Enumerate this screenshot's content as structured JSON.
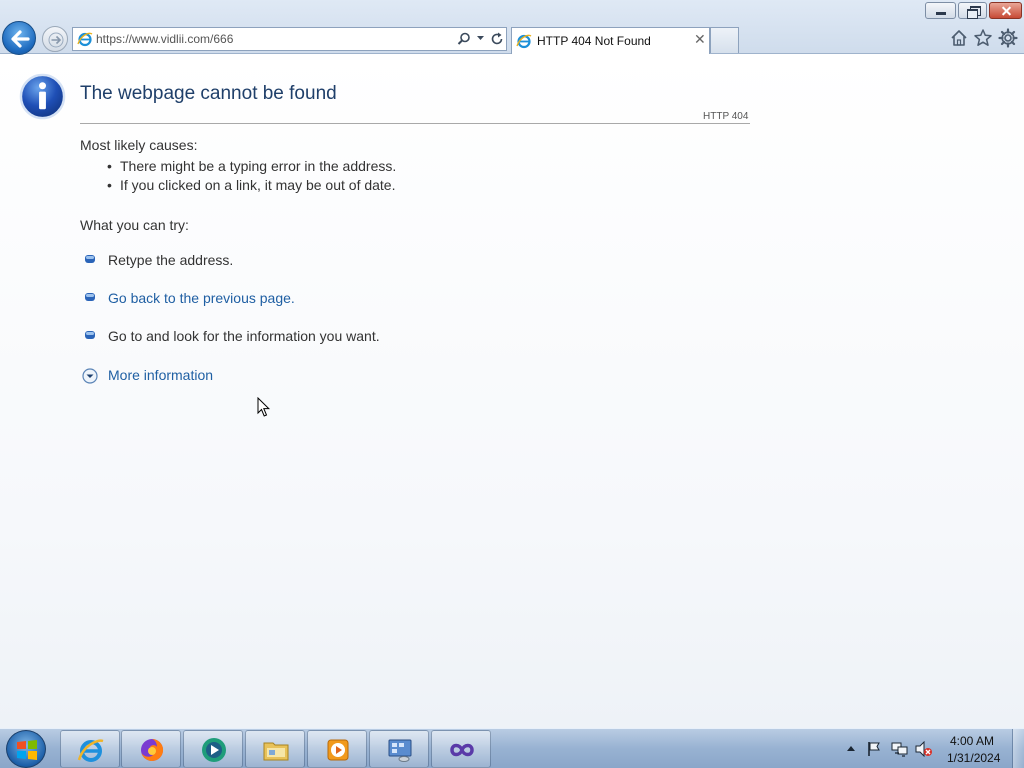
{
  "browser": {
    "url": "https://www.vidlii.com/666",
    "tab_title": "HTTP 404 Not Found"
  },
  "page": {
    "title": "The webpage cannot be found",
    "http_code": "HTTP 404",
    "causes_heading": "Most likely causes:",
    "causes": [
      "There might be a typing error in the address.",
      "If you clicked on a link, it may be out of date."
    ],
    "try_heading": "What you can try:",
    "try_items": [
      "Retype the address.",
      "Go back to the previous page.",
      "Go to  and look for the information you want."
    ],
    "more_info": "More information"
  },
  "taskbar": {
    "apps": [
      "internet-explorer",
      "firefox",
      "media-center",
      "windows-explorer",
      "media-player",
      "remote-desktop",
      "visual-studio"
    ]
  },
  "clock": {
    "time": "4:00 AM",
    "date": "1/31/2024"
  },
  "colors": {
    "title": "#1f3f6a",
    "link": "#1f5fa3",
    "body_text": "#333333"
  }
}
